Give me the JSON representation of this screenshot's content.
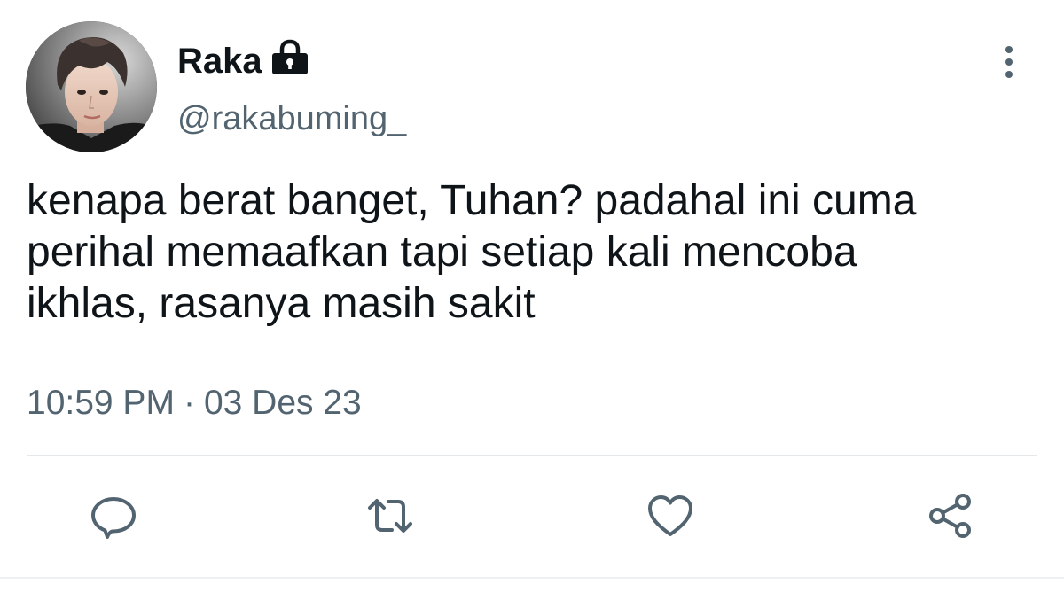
{
  "tweet": {
    "author": {
      "display_name": "Raka",
      "handle": "@rakabuming_",
      "protected_icon": "lock-icon",
      "avatar_icon": "profile-photo"
    },
    "text_lines": [
      "kenapa berat banget, Tuhan? padahal ini cuma",
      "perihal memaafkan tapi setiap kali mencoba",
      "ikhlas, rasanya masih sakit"
    ],
    "time": "10:59 PM",
    "separator": "·",
    "date": "03 Des 23",
    "menu_icon": "more-vertical-icon",
    "actions": [
      {
        "name": "reply",
        "icon": "reply-icon"
      },
      {
        "name": "retweet",
        "icon": "retweet-icon"
      },
      {
        "name": "like",
        "icon": "heart-icon"
      },
      {
        "name": "share",
        "icon": "share-icon"
      }
    ]
  },
  "colors": {
    "text_primary": "#0f1419",
    "text_secondary": "#536471",
    "divider": "#e4e8eb",
    "background": "#ffffff"
  }
}
